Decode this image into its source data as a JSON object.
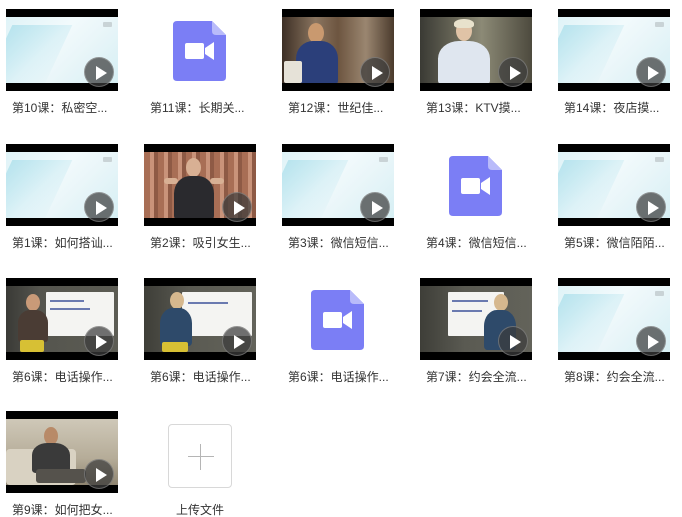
{
  "files": [
    {
      "name": "第10课：私密空...",
      "kind": "video"
    },
    {
      "name": "第11课：长期关...",
      "kind": "file"
    },
    {
      "name": "第12课：世纪佳...",
      "kind": "video"
    },
    {
      "name": "第13课：KTV摸...",
      "kind": "video"
    },
    {
      "name": "第14课：夜店摸...",
      "kind": "video"
    },
    {
      "name": "第1课：如何搭讪...",
      "kind": "video"
    },
    {
      "name": "第2课：吸引女生...",
      "kind": "video"
    },
    {
      "name": "第3课：微信短信...",
      "kind": "video"
    },
    {
      "name": "第4课：微信短信...",
      "kind": "file"
    },
    {
      "name": "第5课：微信陌陌...",
      "kind": "video"
    },
    {
      "name": "第6课：电话操作...",
      "kind": "video"
    },
    {
      "name": "第6课：电话操作...",
      "kind": "video"
    },
    {
      "name": "第6课：电话操作...",
      "kind": "file"
    },
    {
      "name": "第7课：约会全流...",
      "kind": "video"
    },
    {
      "name": "第8课：约会全流...",
      "kind": "video"
    },
    {
      "name": "第9课：如何把女...",
      "kind": "video"
    }
  ],
  "upload": {
    "label": "上传文件"
  },
  "colors": {
    "file_icon": "#7b7ef5",
    "file_icon_fold": "#b9bbfa",
    "play_bg": "#3c3c3c"
  }
}
